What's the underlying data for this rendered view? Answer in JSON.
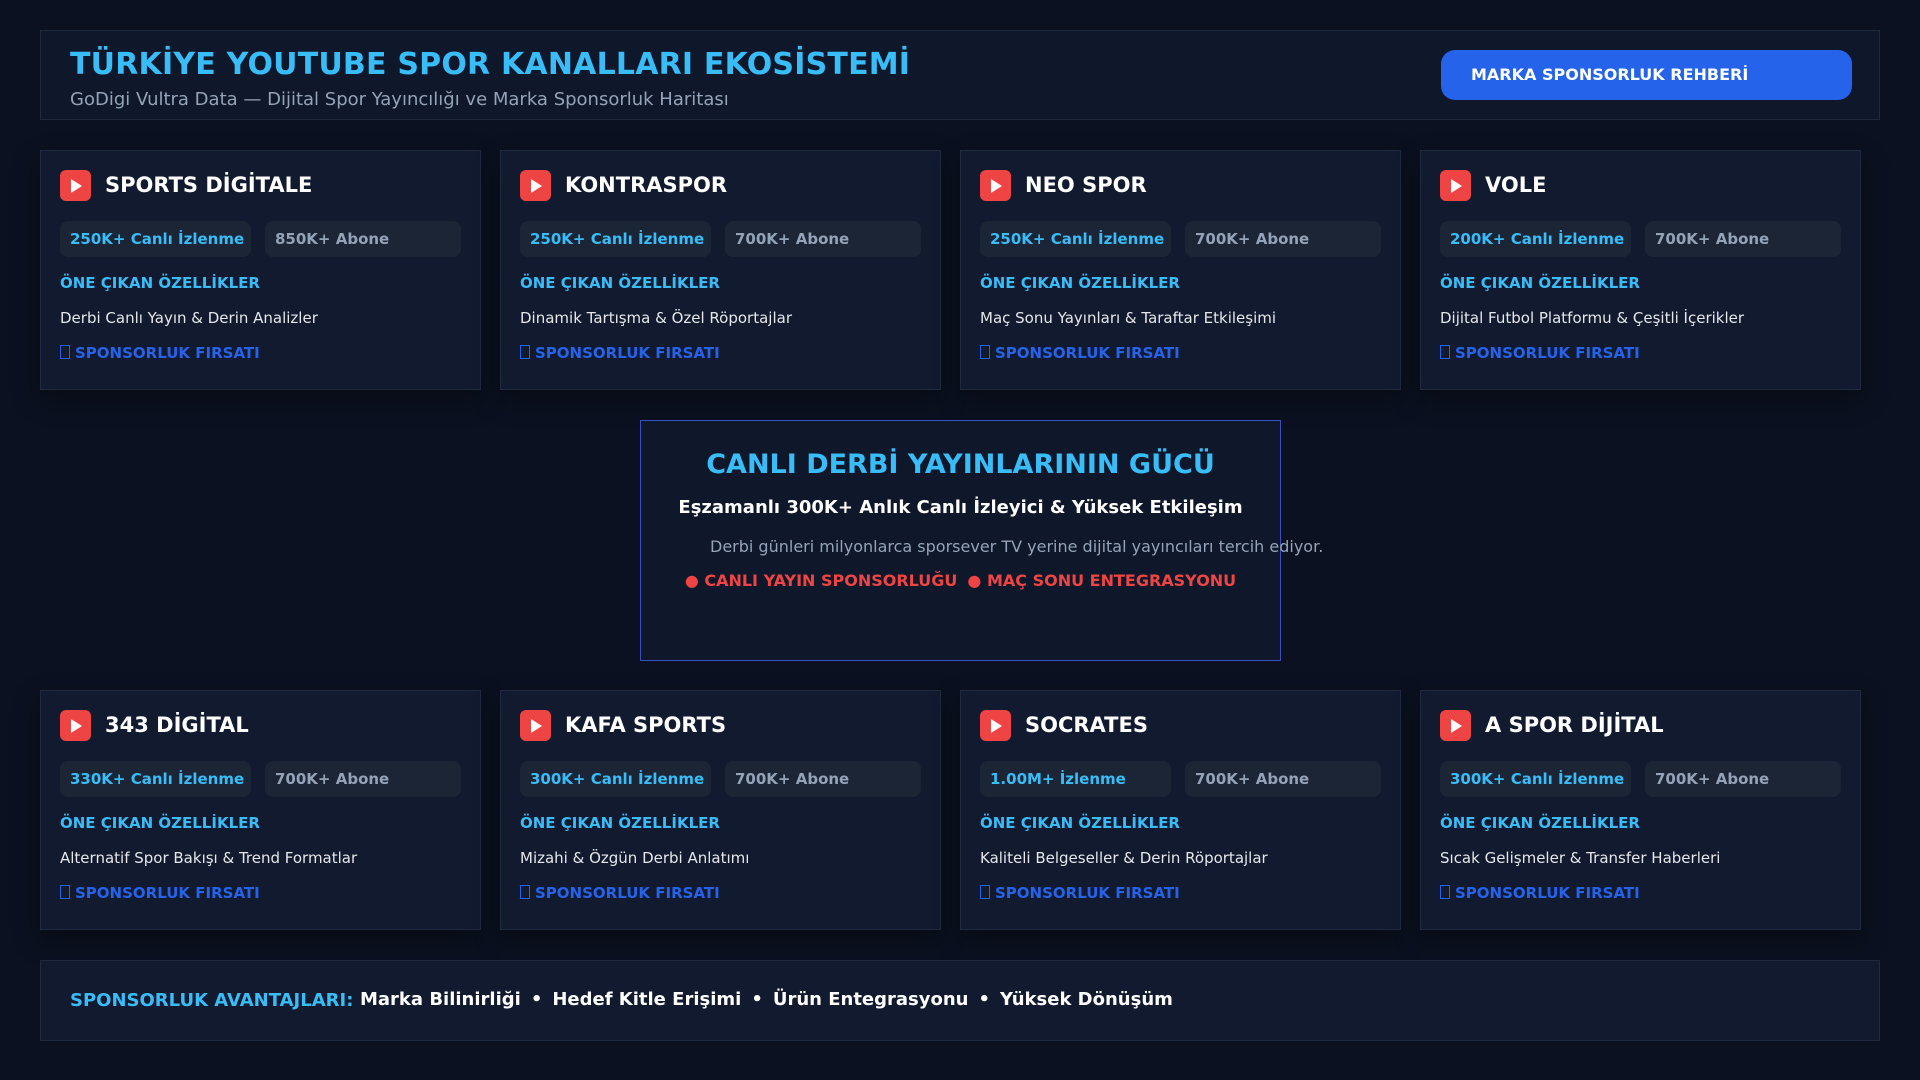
{
  "header": {
    "title": "TÜRKİYE YOUTUBE SPOR KANALLARI EKOSİSTEMİ",
    "subtitle": "GoDigi Vultra Data — Dijital Spor Yayıncılığı ve Marka Sponsorluk Haritası",
    "cta_label": "MARKA SPONSORLUK REHBERİ"
  },
  "labels": {
    "features_heading": "ÖNE ÇIKAN ÖZELLİKLER",
    "sponsorship": "SPONSORLUK FIRSATI"
  },
  "channels_top": [
    {
      "name": "SPORTS DİGİTALE",
      "views": "250K+ Canlı İzlenme",
      "subs": "850K+ Abone",
      "feature": "Derbi Canlı Yayın & Derin Analizler"
    },
    {
      "name": "KONTRASPOR",
      "views": "250K+ Canlı İzlenme",
      "subs": "700K+ Abone",
      "feature": "Dinamik Tartışma & Özel Röportajlar"
    },
    {
      "name": "NEO SPOR",
      "views": "250K+ Canlı İzlenme",
      "subs": "700K+ Abone",
      "feature": "Maç Sonu Yayınları & Taraftar Etkileşimi"
    },
    {
      "name": "VOLE",
      "views": "200K+ Canlı İzlenme",
      "subs": "700K+ Abone",
      "feature": "Dijital Futbol Platformu & Çeşitli İçerikler"
    }
  ],
  "channels_bottom": [
    {
      "name": "343 DİGİTAL",
      "views": "330K+ Canlı İzlenme",
      "subs": "700K+ Abone",
      "feature": "Alternatif Spor Bakışı & Trend Formatlar"
    },
    {
      "name": "KAFA SPORTS",
      "views": "300K+ Canlı İzlenme",
      "subs": "700K+ Abone",
      "feature": "Mizahi & Özgün Derbi Anlatımı"
    },
    {
      "name": "SOCRATES",
      "views": "1.00M+ İzlenme",
      "subs": "700K+ Abone",
      "feature": "Kaliteli Belgeseller & Derin Röportajlar"
    },
    {
      "name": "A SPOR DİJİTAL",
      "views": "300K+ Canlı İzlenme",
      "subs": "700K+ Abone",
      "feature": "Sıcak Gelişmeler & Transfer Haberleri"
    }
  ],
  "center": {
    "title": "CANLI DERBİ YAYINLARININ GÜCÜ",
    "subtitle": "Eşzamanlı 300K+ Anlık Canlı İzleyici & Yüksek Etkileşim",
    "description": "Derbi günleri milyonlarca sporsever TV yerine dijital yayıncıları tercih ediyor.",
    "bullets": [
      "● CANLI YAYIN SPONSORLUĞU",
      "● MAÇ SONU ENTEGRASYONU"
    ]
  },
  "footer": {
    "label": "SPONSORLUK AVANTAJLARI:",
    "items": [
      "Marka Bilinirliği",
      "Hedef Kitle Erişimi",
      "Ürün Entegrasyonu",
      "Yüksek Dönüşüm"
    ],
    "separator": "•"
  },
  "colors": {
    "background": "#0b1120",
    "accent": "#38bdf8",
    "primary": "#2563eb",
    "youtube_red": "#ef4444"
  }
}
